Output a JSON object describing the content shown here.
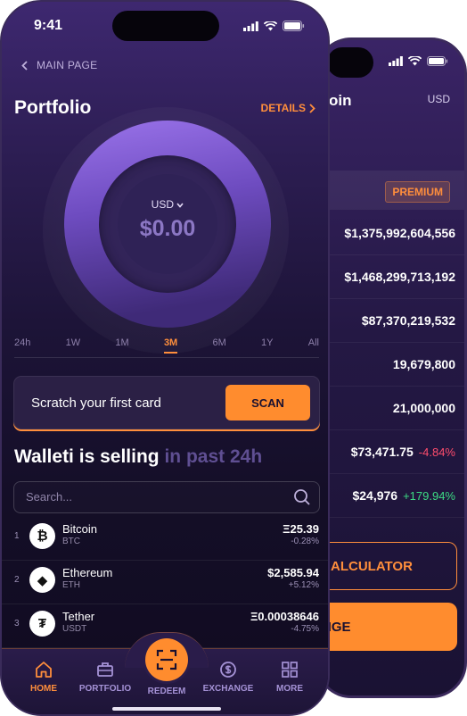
{
  "status": {
    "time": "9:41"
  },
  "back_screen": {
    "title_fragment": "oin",
    "currency": "USD",
    "badge": "PREMIUM",
    "rows": [
      {
        "value": "$1,375,992,604,556",
        "change": "",
        "dir": ""
      },
      {
        "value": "$1,468,299,713,192",
        "change": "",
        "dir": ""
      },
      {
        "value": "$87,370,219,532",
        "change": "",
        "dir": ""
      },
      {
        "value": "19,679,800",
        "change": "",
        "dir": ""
      },
      {
        "value": "21,000,000",
        "change": "",
        "dir": ""
      },
      {
        "value": "$73,471.75",
        "change": "-4.84%",
        "dir": "neg"
      },
      {
        "value": "$24,976",
        "change": "+179.94%",
        "dir": "pos"
      }
    ],
    "calc_label": "ALCULATOR",
    "exchange_label": "NGE"
  },
  "nav": {
    "back_label": "MAIN PAGE"
  },
  "portfolio": {
    "title": "Portfolio",
    "details_label": "DETAILS",
    "currency": "USD",
    "amount": "$0.00"
  },
  "ranges": {
    "items": [
      "24h",
      "1W",
      "1M",
      "3M",
      "6M",
      "1Y",
      "All"
    ],
    "selected": "3M"
  },
  "scratch": {
    "text": "Scratch your first card",
    "button": "SCAN"
  },
  "selling": {
    "title": "Walleti is selling",
    "suffix": "in past 24h"
  },
  "search": {
    "placeholder": "Search..."
  },
  "coins": [
    {
      "rank": "1",
      "name": "Bitcoin",
      "symbol": "BTC",
      "price": "Ξ25.39",
      "change": "-0.28%",
      "logo": "₿"
    },
    {
      "rank": "2",
      "name": "Ethereum",
      "symbol": "ETH",
      "price": "$2,585.94",
      "change": "+5.12%",
      "logo": "◆"
    },
    {
      "rank": "3",
      "name": "Tether",
      "symbol": "USDT",
      "price": "Ξ0.00038646",
      "change": "-4.75%",
      "logo": "₮"
    }
  ],
  "tabs": {
    "home": "HOME",
    "portfolio": "PORTFOLIO",
    "redeem": "REDEEM",
    "exchange": "EXCHANGE",
    "more": "MORE"
  },
  "colors": {
    "accent": "#ff8c2e",
    "background": "#140e27",
    "positive": "#3ddc84",
    "negative": "#ff4d6d"
  }
}
